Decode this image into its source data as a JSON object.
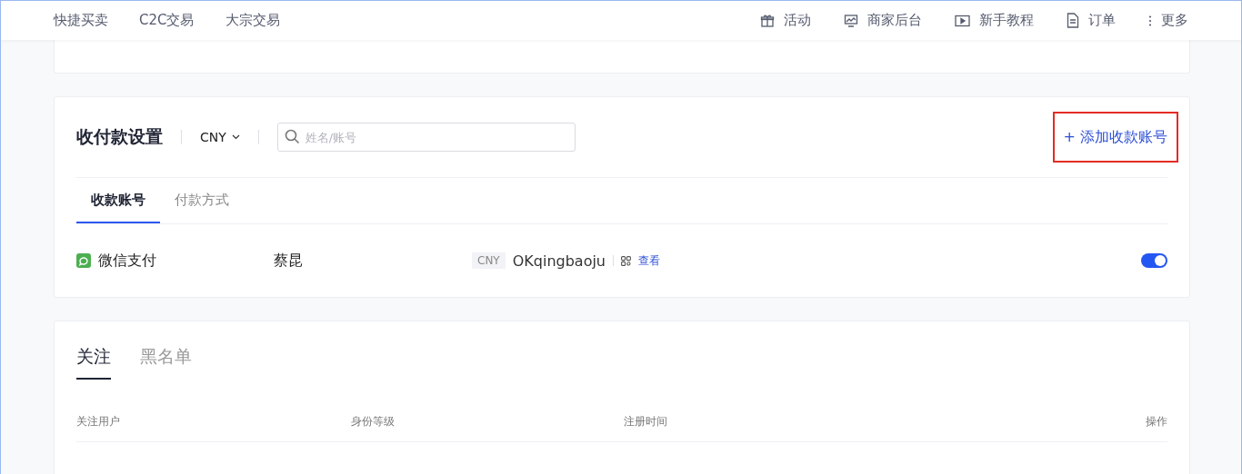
{
  "nav": {
    "left": [
      {
        "label": "快捷买卖"
      },
      {
        "label": "C2C交易"
      },
      {
        "label": "大宗交易"
      }
    ],
    "right": [
      {
        "label": "活动",
        "kind": "gift"
      },
      {
        "label": "商家后台",
        "kind": "monitor"
      },
      {
        "label": "新手教程",
        "kind": "play"
      },
      {
        "label": "订单",
        "kind": "doc"
      },
      {
        "label": "更多",
        "kind": "dots"
      }
    ]
  },
  "payment": {
    "title": "收付款设置",
    "currency": "CNY",
    "search": {
      "placeholder": "姓名/账号"
    },
    "add_button": {
      "label": "+ 添加收款账号",
      "highlighted": true
    },
    "tabs": [
      {
        "label": "收款账号",
        "selected": true
      },
      {
        "label": "付款方式",
        "selected": false
      }
    ],
    "accounts": [
      {
        "method": "微信支付",
        "name": "蔡昆",
        "currency": "CNY",
        "account": "OKqingbaoju",
        "view": "查看",
        "on": true
      }
    ]
  },
  "follow": {
    "tabs": [
      {
        "label": "关注",
        "selected": true
      },
      {
        "label": "黑名单",
        "selected": false
      }
    ],
    "columns": [
      "关注用户",
      "身份等级",
      "注册时间",
      "操作"
    ]
  }
}
